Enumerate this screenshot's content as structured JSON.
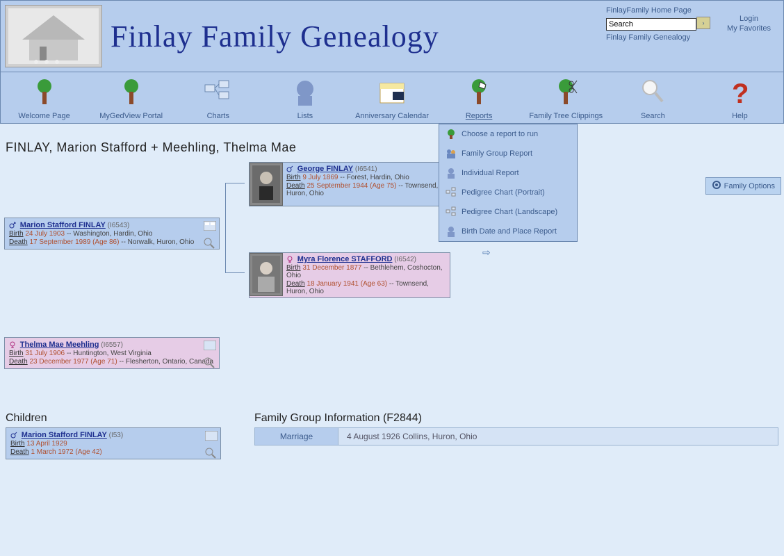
{
  "header": {
    "title": "Finlay Family Genealogy",
    "links": {
      "home": "FinlayFamily Home Page",
      "sub": "Finlay Family Genealogy"
    },
    "search_value": "Search",
    "login": "Login",
    "favorites": "My Favorites"
  },
  "nav": [
    {
      "label": "Welcome Page"
    },
    {
      "label": "MyGedView Portal"
    },
    {
      "label": "Charts"
    },
    {
      "label": "Lists"
    },
    {
      "label": "Anniversary Calendar"
    },
    {
      "label": "Reports",
      "active": true
    },
    {
      "label": "Family Tree Clippings"
    },
    {
      "label": "Search"
    },
    {
      "label": "Help"
    }
  ],
  "dropdown": [
    "Choose a report to run",
    "Family Group Report",
    "Individual Report",
    "Pedigree Chart (Portrait)",
    "Pedigree Chart (Landscape)",
    "Birth Date and Place Report"
  ],
  "breadcrumb": "FINLAY, Marion Stafford + Meehling, Thelma Mae",
  "family_options": "Family Options",
  "husband": {
    "name": "Marion Stafford FINLAY",
    "id": "(I6543)",
    "birth": "24 July 1903",
    "birth_place": "-- Washington, Hardin, Ohio",
    "death": "17 September 1989 (Age 86)",
    "death_place": "-- Norwalk, Huron, Ohio"
  },
  "father": {
    "name": "George FINLAY",
    "id": "(I6541)",
    "birth": "9 July 1869",
    "birth_place": "-- Forest, Hardin, Ohio",
    "death": "25 September 1944 (Age 75)",
    "death_place": "-- Townsend, Huron, Ohio"
  },
  "mother": {
    "name": "Myra Florence STAFFORD",
    "id": "(I6542)",
    "birth": "31 December 1877",
    "birth_place": "-- Bethlehem, Coshocton, Ohio",
    "death": "18 January 1941 (Age 63)",
    "death_place": "-- Townsend, Huron, Ohio"
  },
  "wife": {
    "name": "Thelma Mae Meehling",
    "id": "(I6557)",
    "birth": "31 July 1906",
    "birth_place": "-- Huntington, West Virginia",
    "death": "23 December 1977 (Age 71)",
    "death_place": "-- Flesherton, Ontario, Canada"
  },
  "children_h": "Children",
  "child": {
    "name": "Marion Stafford FINLAY",
    "id": "(I53)",
    "birth": "13 April 1929",
    "death": "1 March 1972 (Age 42)"
  },
  "group_h": "Family Group Information (F2844)",
  "group_row": {
    "label": "Marriage",
    "value": "4 August 1926 Collins, Huron, Ohio"
  },
  "lbl": {
    "birth": "Birth",
    "death": "Death"
  }
}
